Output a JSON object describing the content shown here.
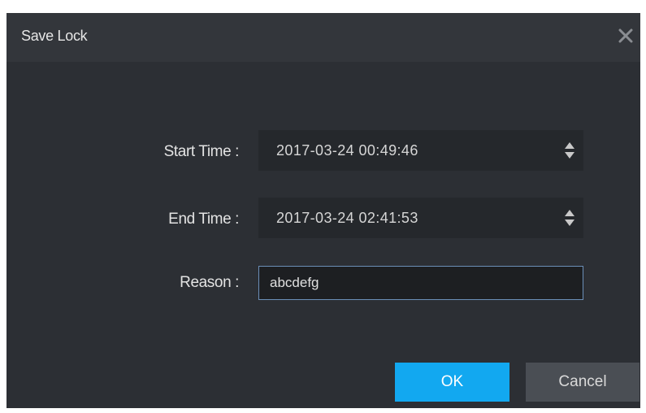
{
  "dialog": {
    "title": "Save Lock"
  },
  "form": {
    "start_time": {
      "label": "Start Time :",
      "value": "2017-03-24 00:49:46"
    },
    "end_time": {
      "label": "End Time :",
      "value": "2017-03-24 02:41:53"
    },
    "reason": {
      "label": "Reason :",
      "value": "abcdefg"
    }
  },
  "buttons": {
    "ok_label": "OK",
    "cancel_label": "Cancel"
  },
  "icons": {
    "close": "close-icon",
    "spinner": "spinner-updown-icon"
  },
  "colors": {
    "dialog_bg": "#2c2f34",
    "titlebar_bg": "#33363b",
    "field_bg": "#25282c",
    "accent": "#12a8f0",
    "cancel_bg": "#4a4e54",
    "focus_border": "#6b8fb8"
  }
}
